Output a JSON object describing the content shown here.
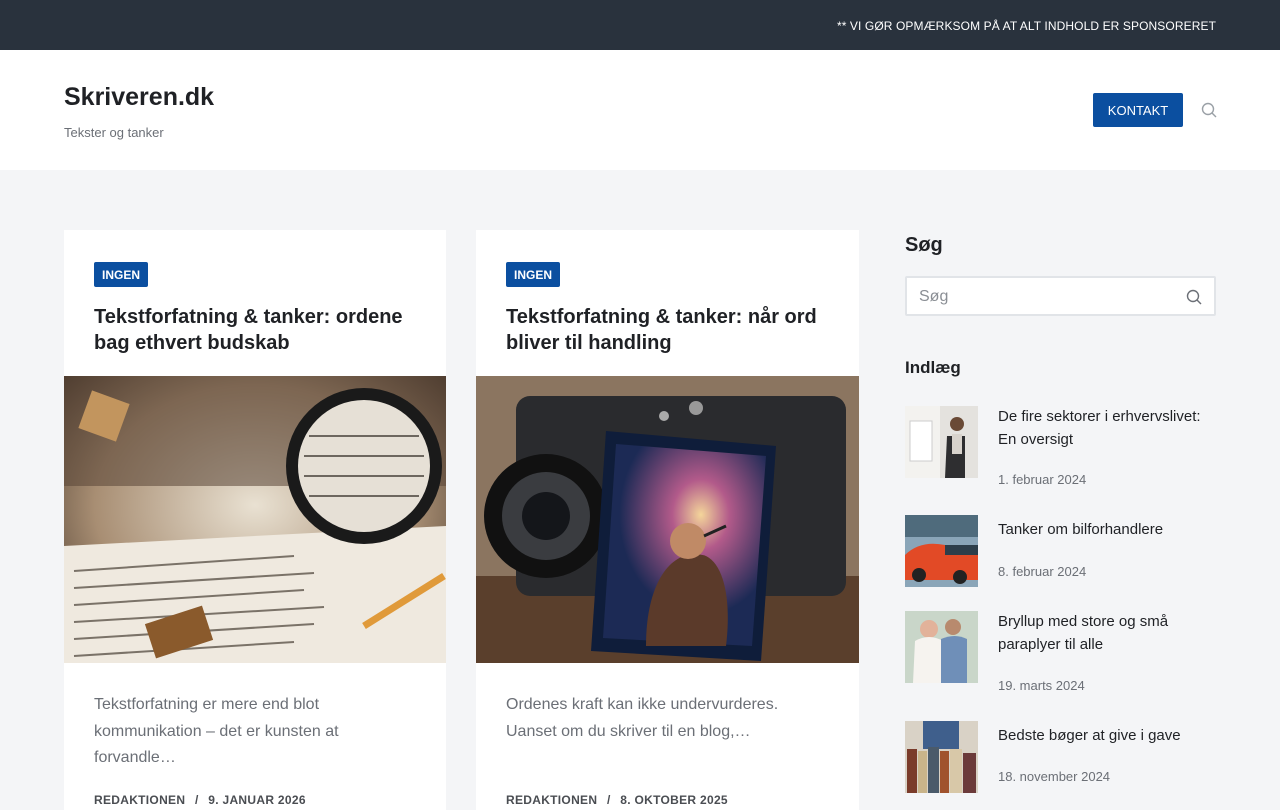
{
  "topbar": {
    "notice": "** VI GØR OPMÆRKSOM PÅ AT ALT INDHOLD ER SPONSORERET"
  },
  "header": {
    "site_title": "Skriveren.dk",
    "tagline": "Tekster og tanker",
    "contact_label": "KONTAKT",
    "search_icon": "search-icon"
  },
  "posts": [
    {
      "category": "INGEN",
      "title": "Tekstforfatning & tanker: ordene bag ethvert budskab",
      "excerpt": "Tekstforfatning er mere end blot kommunikation – det er kunsten at forvandle…",
      "author": "REDAKTIONEN",
      "separator": "/",
      "date": "9. JANUAR 2026"
    },
    {
      "category": "INGEN",
      "title": "Tekstforfatning & tanker: når ord bliver til handling",
      "excerpt": "Ordenes kraft kan ikke undervurderes. Uanset om du skriver til en blog,…",
      "author": "REDAKTIONEN",
      "separator": "/",
      "date": "8. OKTOBER 2025"
    }
  ],
  "sidebar": {
    "search_heading": "Søg",
    "search_placeholder": "Søg",
    "posts_heading": "Indlæg",
    "recent": [
      {
        "title": "De fire sektorer i erhvervslivet: En oversigt",
        "date": "1. februar 2024"
      },
      {
        "title": "Tanker om bilforhandlere",
        "date": "8. februar 2024"
      },
      {
        "title": "Bryllup med store og små paraplyer til alle",
        "date": "19. marts 2024"
      },
      {
        "title": "Bedste bøger at give i gave",
        "date": "18. november 2024"
      }
    ]
  },
  "colors": {
    "topbar": "#29323d",
    "accent": "#0b4fa0",
    "background": "#f4f5f7"
  }
}
